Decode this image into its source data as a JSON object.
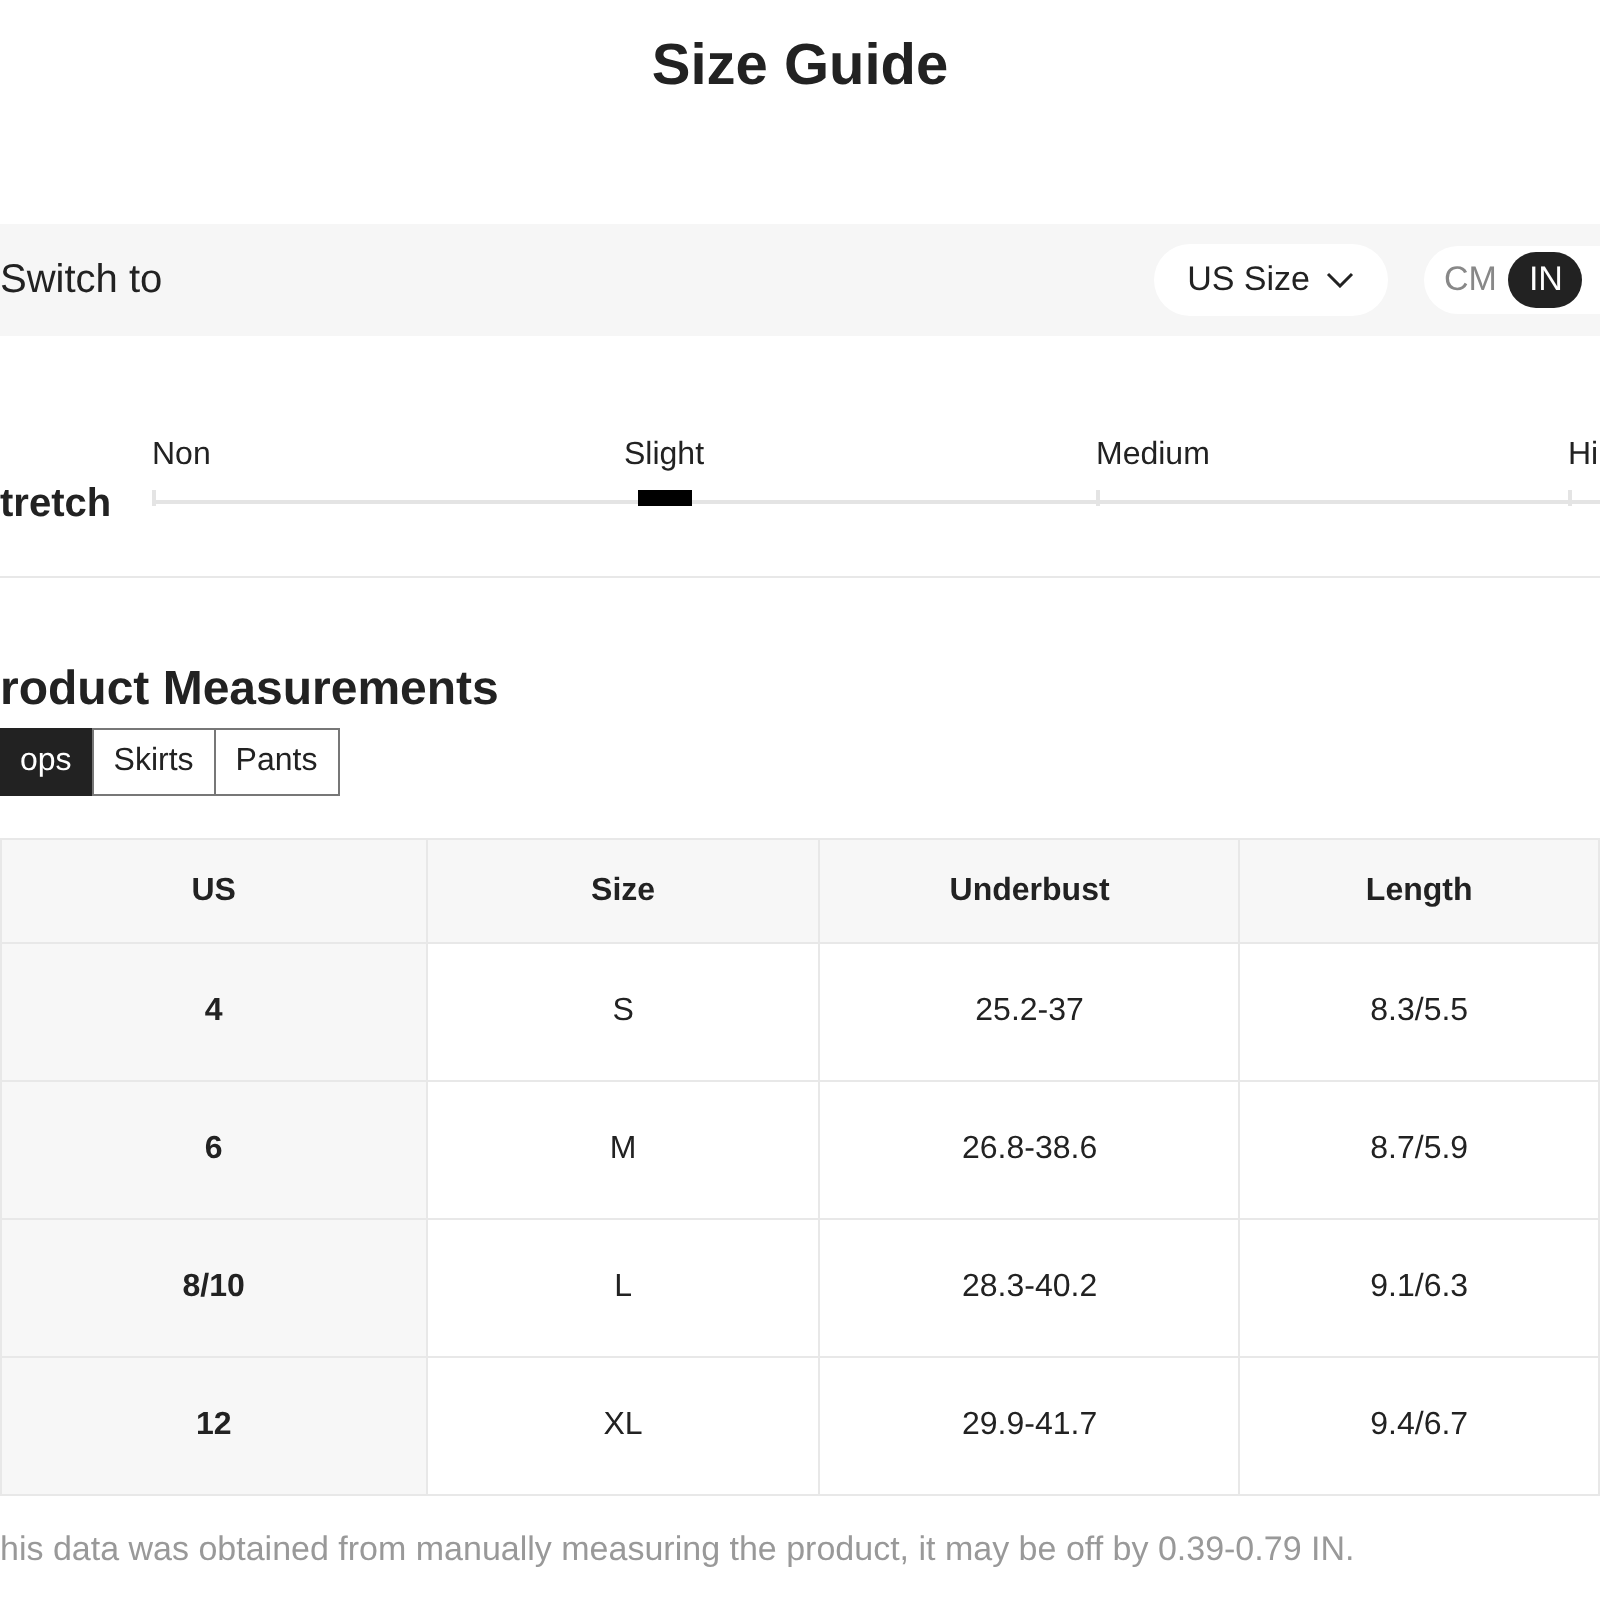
{
  "title": "Size Guide",
  "switch_bar": {
    "label": "Switch to",
    "size_system": "US Size",
    "units": [
      {
        "label": "CM",
        "selected": false
      },
      {
        "label": "IN",
        "selected": true
      }
    ]
  },
  "stretch": {
    "label": "tretch",
    "levels": [
      {
        "label": "Non",
        "selected": false
      },
      {
        "label": "Slight",
        "selected": true
      },
      {
        "label": "Medium",
        "selected": false
      },
      {
        "label": "Hi",
        "selected": false
      }
    ]
  },
  "measurements": {
    "heading": "roduct Measurements",
    "tabs": [
      {
        "label": "ops",
        "selected": true
      },
      {
        "label": "Skirts",
        "selected": false
      },
      {
        "label": "Pants",
        "selected": false
      }
    ],
    "table": {
      "columns": [
        "US",
        "Size",
        "Underbust",
        "Length"
      ],
      "rows": [
        [
          "4",
          "S",
          "25.2-37",
          "8.3/5.5"
        ],
        [
          "6",
          "M",
          "26.8-38.6",
          "8.7/5.9"
        ],
        [
          "8/10",
          "L",
          "28.3-40.2",
          "9.1/6.3"
        ],
        [
          "12",
          "XL",
          "29.9-41.7",
          "9.4/6.7"
        ]
      ]
    },
    "note": "his data was obtained from manually measuring the product, it may be off by 0.39-0.79 IN."
  }
}
